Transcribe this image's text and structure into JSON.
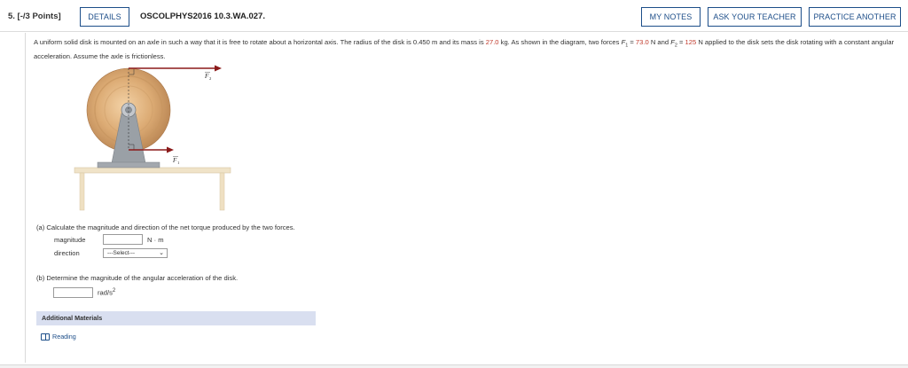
{
  "header": {
    "question_number": "5. [-/3 Points]",
    "details_label": "DETAILS",
    "problem_code": "OSCOLPHYS2016 10.3.WA.027.",
    "my_notes_label": "MY NOTES",
    "ask_teacher_label": "ASK YOUR TEACHER",
    "practice_label": "PRACTICE ANOTHER"
  },
  "problem": {
    "text_1": "A uniform solid disk is mounted on an axle in such a way that it is free to rotate about a horizontal axis. The radius of the disk is 0.450 m and its mass is ",
    "mass": "27.0",
    "text_2": " kg. As shown in the diagram, two forces ",
    "f1_symbol": "F",
    "f1_sub": "1",
    "text_3": " = ",
    "f1_value": "73.0",
    "text_4": " N and ",
    "f2_symbol": "F",
    "f2_sub": "2",
    "text_5": " = ",
    "f2_value": "125",
    "text_6": " N applied to the disk sets the disk rotating with a constant angular acceleration. Assume the axle is frictionless."
  },
  "figure": {
    "f2_label": "F",
    "f2_sub": "2",
    "f1_label": "F",
    "f1_sub": "1"
  },
  "part_a": {
    "prompt": "(a)   Calculate the magnitude and direction of the net torque produced by the two forces.",
    "magnitude_label": "magnitude",
    "magnitude_value": "",
    "magnitude_unit": "N · m",
    "direction_label": "direction",
    "direction_selected": "---Select---"
  },
  "part_b": {
    "prompt": "(b)   Determine the magnitude of the angular acceleration of the disk.",
    "alpha_value": "",
    "alpha_unit": "rad/s",
    "alpha_unit_exp": "2"
  },
  "additional": {
    "title": "Additional Materials",
    "reading_label": "Reading"
  },
  "colors": {
    "accent": "#1d4e89",
    "value_red": "#c0392b",
    "additional_bg": "#d9dff0"
  }
}
